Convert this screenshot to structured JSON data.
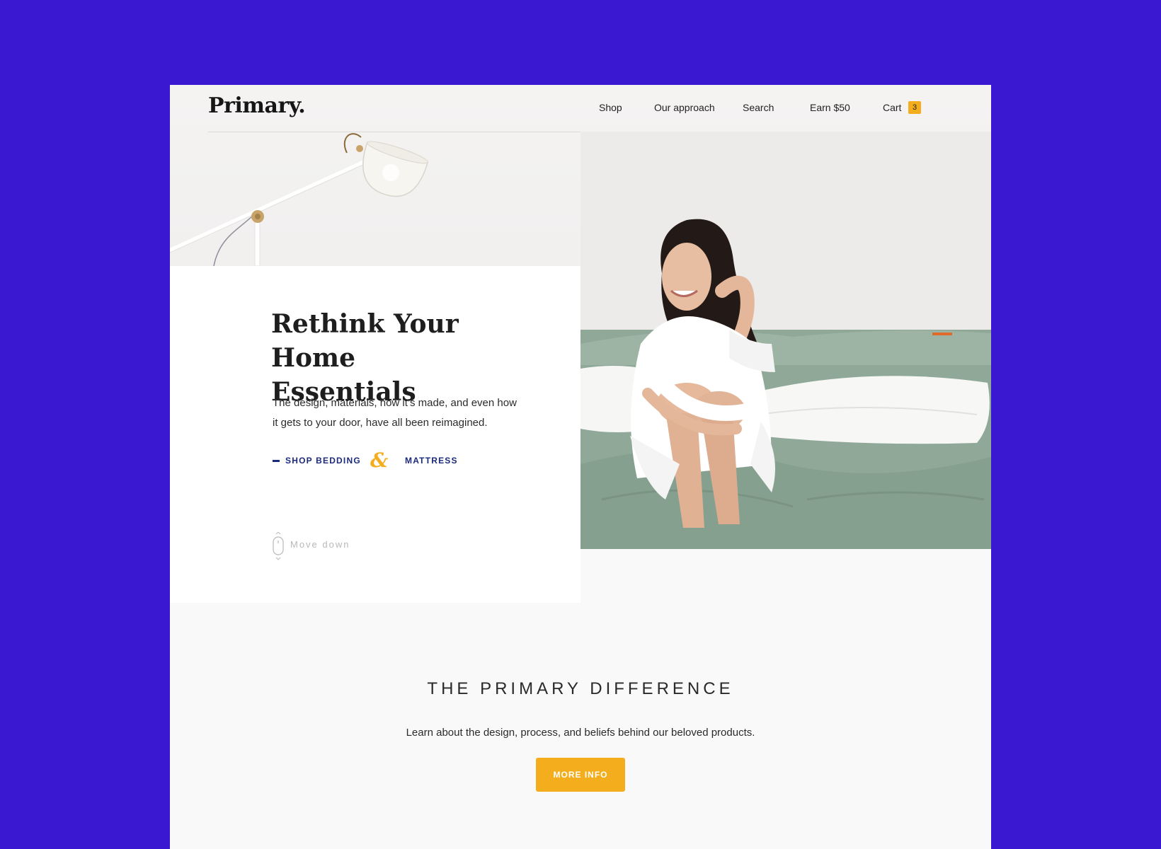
{
  "brand": {
    "logo": "Primary."
  },
  "nav": {
    "items": [
      {
        "label": "Shop"
      },
      {
        "label": "Our approach"
      },
      {
        "label": "Search"
      },
      {
        "label": "Earn $50"
      },
      {
        "label": "Cart"
      }
    ],
    "cart_count": "3"
  },
  "hero": {
    "headline_line1": "Rethink Your Home",
    "headline_line2": "Essentials",
    "body": "The design, materials, how it’s made, and even how it gets to your door, have all been reimagined.",
    "link_bedding": "SHOP BEDDING",
    "ampersand": "&",
    "link_mattress": "MATTRESS",
    "scroll_hint": "Move down"
  },
  "difference": {
    "title": "THE PRIMARY DIFFERENCE",
    "subtitle": "Learn about the design, process, and beliefs  behind our beloved products.",
    "button_label": "MORE INFO"
  },
  "colors": {
    "background": "#3a17d0",
    "accent": "#f4ad1c",
    "link": "#1b2a7a",
    "sheet_green": "#8fa898"
  },
  "images": {
    "hero_photo": "woman-sitting-on-bed-photo",
    "lamp": "floor-lamp-illustration"
  }
}
